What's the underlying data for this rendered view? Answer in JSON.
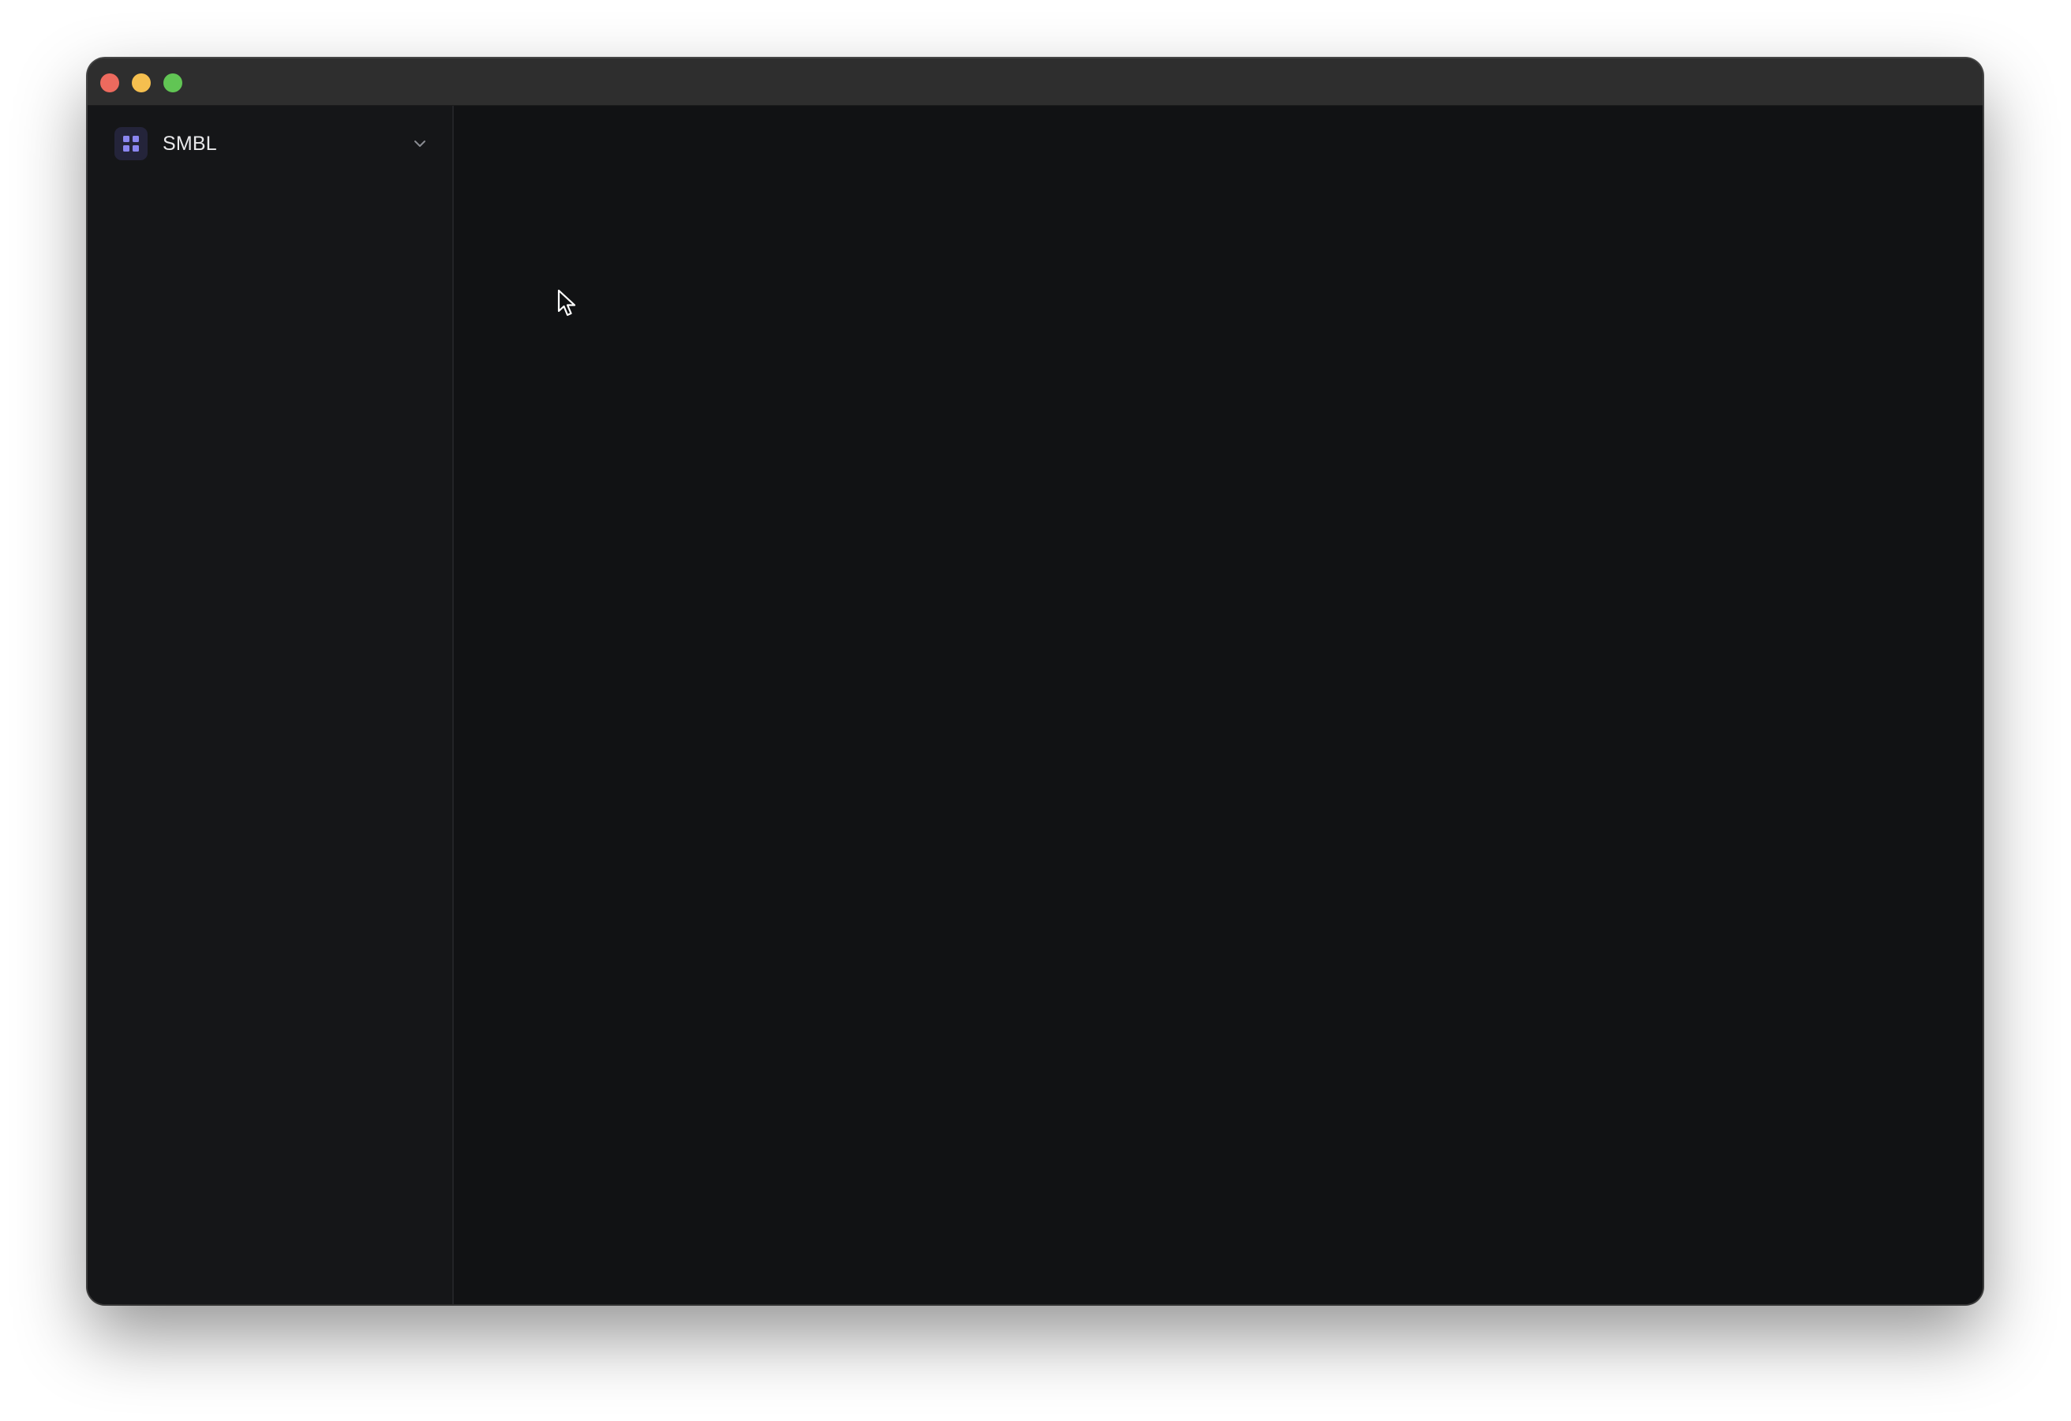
{
  "window": {
    "controls": {
      "close_icon": "close-icon",
      "minimize_icon": "minimize-icon",
      "zoom_icon": "zoom-icon"
    }
  },
  "sidebar": {
    "workspace": {
      "name": "SMBL",
      "icon": "grid-icon",
      "dropdown_icon": "chevron-down-icon"
    }
  },
  "colors": {
    "titlebar": "#2e2e2e",
    "sidebar": "#151618",
    "main": "#111214",
    "accent": "#8b86f0",
    "close": "#ed6a5e",
    "minimize": "#f5bf4f",
    "zoom": "#61c554"
  }
}
